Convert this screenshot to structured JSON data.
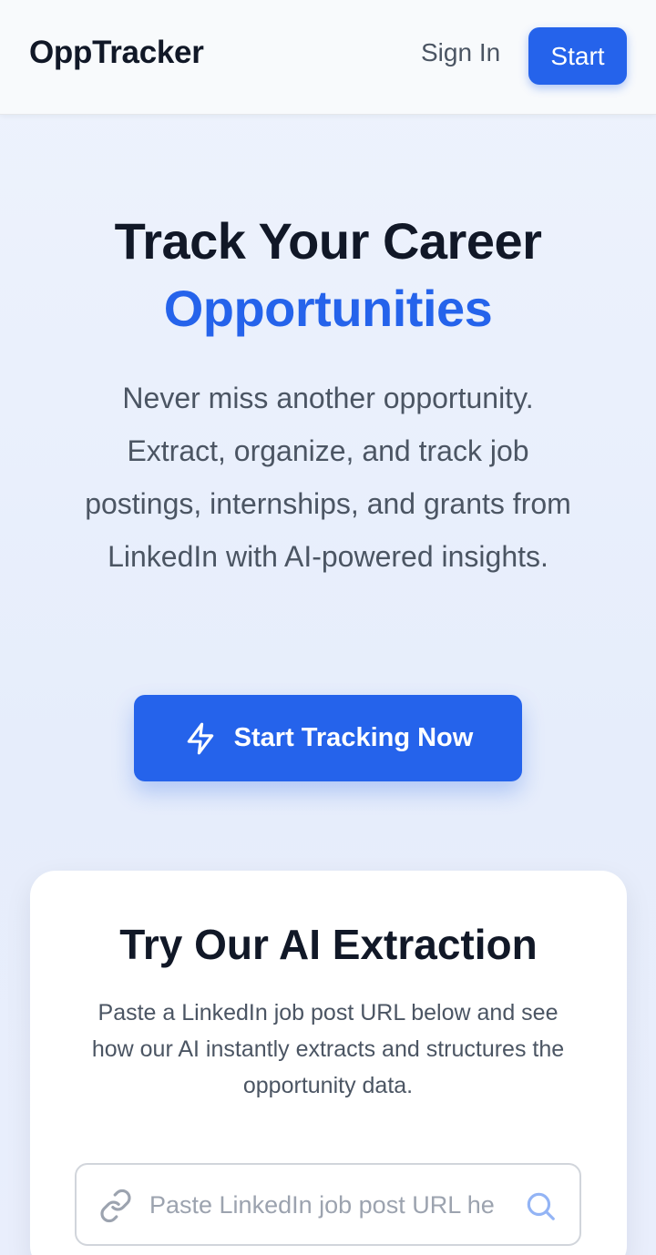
{
  "nav": {
    "brand": "OppTracker",
    "sign_in_label": "Sign In",
    "start_label": "Start"
  },
  "hero": {
    "title_line1": "Track Your Career",
    "title_line2": "Opportunities",
    "subtitle": "Never miss another opportunity. Extract, organize, and track job postings, internships, and grants from LinkedIn with AI-powered insights.",
    "cta_label": "Start Tracking Now",
    "cta_icon": "lightning-icon"
  },
  "extraction": {
    "title": "Try Our AI Extraction",
    "description": "Paste a LinkedIn job post URL below and see how our AI instantly extracts and structures the opportunity data.",
    "input_value": "",
    "input_placeholder": "Paste LinkedIn job post URL here",
    "input_icon": "link-icon",
    "action_icon": "search-icon"
  },
  "colors": {
    "accent": "#2563eb",
    "text_dark": "#111827",
    "text_muted": "#4b5563"
  }
}
